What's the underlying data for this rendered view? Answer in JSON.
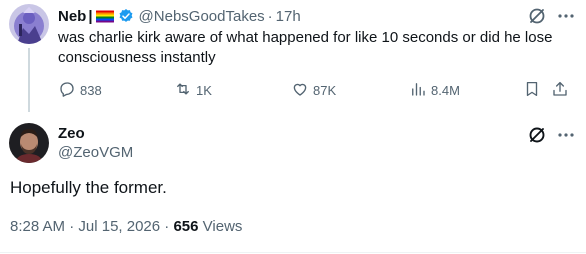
{
  "parent_tweet": {
    "display_name": "Neb",
    "separator": "|",
    "handle": "@NebsGoodTakes",
    "dot": "·",
    "time": "17h",
    "text": "was charlie kirk aware of what happened for like 10 seconds or did he lose consciousness instantly",
    "stats": {
      "replies": "838",
      "reposts": "1K",
      "likes": "87K",
      "views": "8.4M"
    }
  },
  "focal_tweet": {
    "display_name": "Zeo",
    "handle": "@ZeoVGM",
    "text": "Hopefully the former.",
    "time": "8:28 AM",
    "dot": "·",
    "date": "Jul 15, 2026",
    "view_count": "656",
    "views_label": "Views"
  },
  "icons": {
    "verified": "verified-badge-icon",
    "grok": "grok-icon",
    "more": "more-icon",
    "reply": "reply-icon",
    "repost": "repost-icon",
    "like": "like-icon",
    "views": "views-icon",
    "bookmark": "bookmark-icon",
    "share": "share-icon"
  },
  "colors": {
    "text_primary": "#0f1419",
    "text_secondary": "#536471",
    "verified_blue": "#1d9bf0",
    "thread_line": "#cfd9de"
  }
}
